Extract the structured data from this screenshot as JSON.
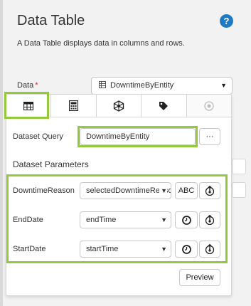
{
  "header": {
    "title": "Data Table",
    "description": "A Data Table displays data in columns and rows."
  },
  "data_field": {
    "label": "Data",
    "required_marker": "*",
    "value": "DowntimeByEntity"
  },
  "tabs": [
    {
      "icon": "table-icon",
      "state": "active"
    },
    {
      "icon": "calculator-icon",
      "state": "normal"
    },
    {
      "icon": "hexagon-network-icon",
      "state": "normal"
    },
    {
      "icon": "tag-icon",
      "state": "normal"
    },
    {
      "icon": "circle-target-icon",
      "state": "disabled"
    }
  ],
  "dataset_query": {
    "label": "Dataset Query",
    "value": "DowntimeByEntity",
    "more_button": "···"
  },
  "parameters": {
    "title": "Dataset Parameters",
    "rows": [
      {
        "name": "DowntimeReason",
        "value": "selectedDowntimeReason",
        "type_button": "ABC"
      },
      {
        "name": "EndDate",
        "value": "endTime",
        "type_button": "clock-icon"
      },
      {
        "name": "StartDate",
        "value": "startTime",
        "type_button": "clock-icon"
      }
    ]
  },
  "preview_button": "Preview",
  "colors": {
    "highlight": "#95c93d",
    "help": "#1f7ac2",
    "required": "#d22222"
  }
}
